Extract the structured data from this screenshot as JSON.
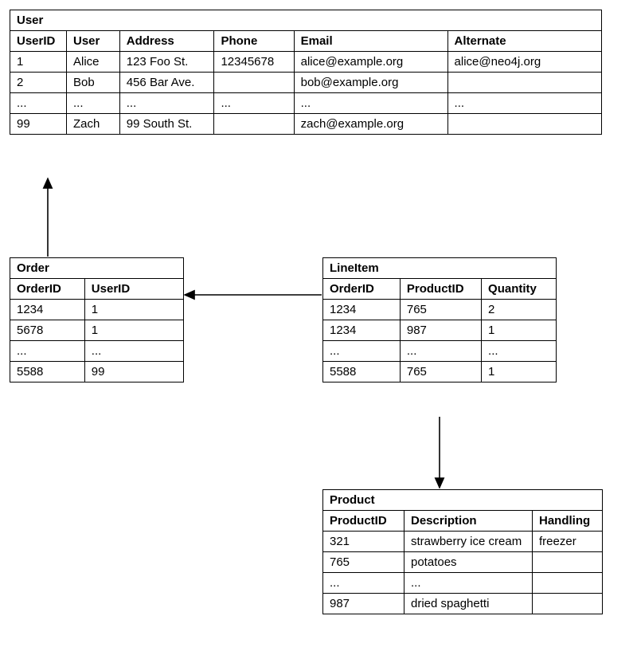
{
  "user": {
    "title": "User",
    "columns": [
      "UserID",
      "User",
      "Address",
      "Phone",
      "Email",
      "Alternate"
    ],
    "rows": [
      [
        "1",
        "Alice",
        "123 Foo St.",
        "12345678",
        "alice@example.org",
        "alice@neo4j.org"
      ],
      [
        "2",
        "Bob",
        "456 Bar Ave.",
        "",
        "bob@example.org",
        ""
      ],
      [
        "...",
        "...",
        "...",
        "...",
        "...",
        "..."
      ],
      [
        "99",
        "Zach",
        "99 South St.",
        "",
        "zach@example.org",
        ""
      ]
    ]
  },
  "order": {
    "title": "Order",
    "columns": [
      "OrderID",
      "UserID"
    ],
    "rows": [
      [
        "1234",
        "1"
      ],
      [
        "5678",
        "1"
      ],
      [
        "...",
        "..."
      ],
      [
        "5588",
        "99"
      ]
    ]
  },
  "lineitem": {
    "title": "LineItem",
    "columns": [
      "OrderID",
      "ProductID",
      "Quantity"
    ],
    "rows": [
      [
        "1234",
        "765",
        "2"
      ],
      [
        "1234",
        "987",
        "1"
      ],
      [
        "...",
        "...",
        "..."
      ],
      [
        "5588",
        "765",
        "1"
      ]
    ]
  },
  "product": {
    "title": "Product",
    "columns": [
      "ProductID",
      "Description",
      "Handling"
    ],
    "rows": [
      [
        "321",
        "strawberry ice cream",
        "freezer"
      ],
      [
        "765",
        "potatoes",
        ""
      ],
      [
        "...",
        "...",
        ""
      ],
      [
        "987",
        "dried spaghetti",
        ""
      ]
    ]
  }
}
